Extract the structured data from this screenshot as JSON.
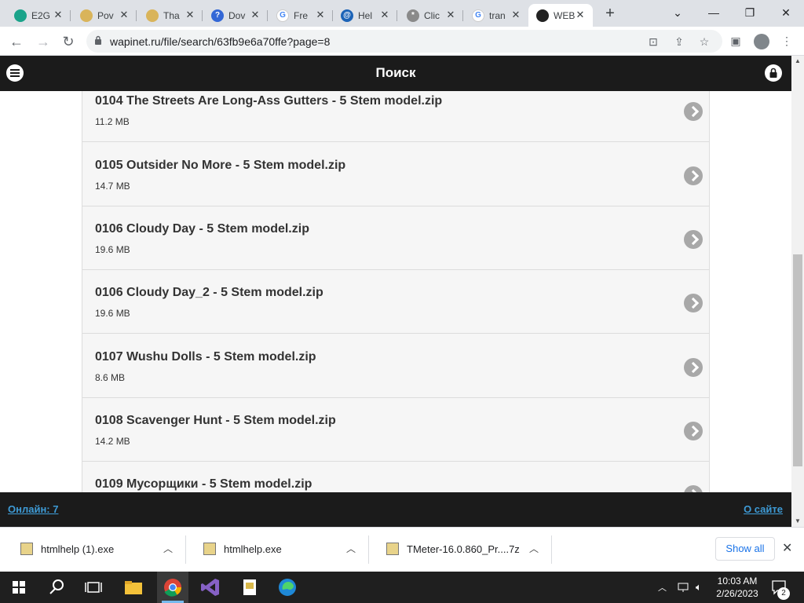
{
  "browser": {
    "tabs": [
      {
        "title": "E2G",
        "color": "#1aa38a",
        "letter": ""
      },
      {
        "title": "Pov",
        "color": "#d9b45a",
        "letter": ""
      },
      {
        "title": "Tha",
        "color": "#d9b45a",
        "letter": ""
      },
      {
        "title": "Dov",
        "color": "#3367d6",
        "letter": "?"
      },
      {
        "title": "Fre",
        "color": "#ffffff",
        "letter": "G"
      },
      {
        "title": "Hel",
        "color": "#1c63b7",
        "letter": "@"
      },
      {
        "title": "Clic",
        "color": "#8a8a8a",
        "letter": "*"
      },
      {
        "title": "tran",
        "color": "#ffffff",
        "letter": "G"
      },
      {
        "title": "WEB",
        "color": "#222222",
        "letter": ""
      }
    ],
    "active_tab": 8,
    "url": "wapinet.ru/file/search/63fb9e6a70ffe?page=8",
    "window_controls": {
      "minimize": "—",
      "maximize": "❐",
      "close": "✕"
    }
  },
  "site": {
    "header_title": "Поиск",
    "files": [
      {
        "name": "0104 The Streets Are Long-Ass Gutters - 5 Stem model.zip",
        "size": "11.2 MB"
      },
      {
        "name": "0105 Outsider No More - 5 Stem model.zip",
        "size": "14.7 MB"
      },
      {
        "name": "0106 Cloudy Day - 5 Stem model.zip",
        "size": "19.6 MB"
      },
      {
        "name": "0106 Cloudy Day_2 - 5 Stem model.zip",
        "size": "19.6 MB"
      },
      {
        "name": "0107 Wushu Dolls - 5 Stem model.zip",
        "size": "8.6 MB"
      },
      {
        "name": "0108 Scavenger Hunt - 5 Stem model.zip",
        "size": "14.2 MB"
      },
      {
        "name": "0109 Мусорщики - 5 Stem model.zip",
        "size": ""
      }
    ],
    "footer": {
      "online": "Онлайн: 7",
      "about": "О сайте"
    }
  },
  "downloads": {
    "items": [
      "htmlhelp (1).exe",
      "htmlhelp.exe",
      "TMeter-16.0.860_Pr....7z"
    ],
    "show_all": "Show all"
  },
  "taskbar": {
    "time": "10:03 AM",
    "date": "2/26/2023",
    "notifications": "2"
  }
}
